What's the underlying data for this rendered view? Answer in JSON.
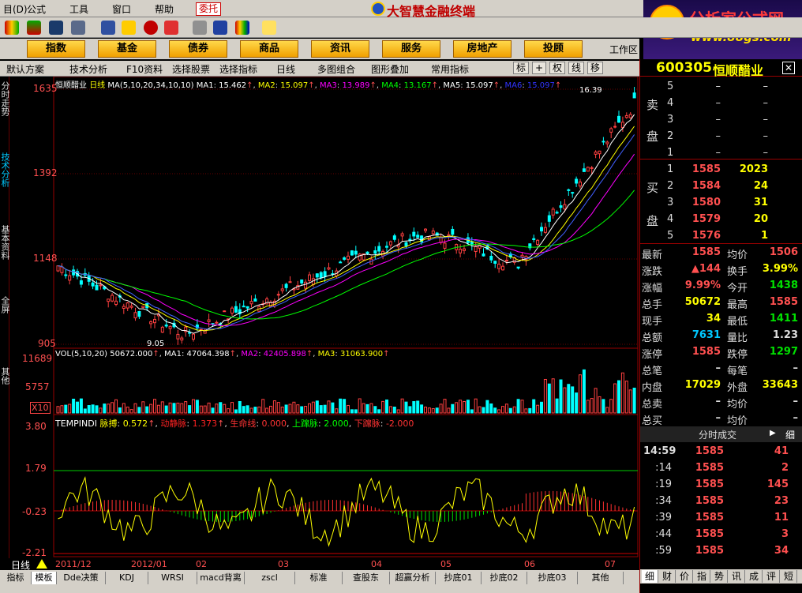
{
  "menu": {
    "items": [
      "目(D)",
      "公式",
      "工具",
      "窗口",
      "帮助"
    ],
    "delegate": "委托",
    "app_title": "大智慧金融终端"
  },
  "brand": {
    "name": "分析家公式网",
    "url": "www.88gs.com"
  },
  "categories": [
    "指数",
    "基金",
    "债券",
    "商品",
    "资讯",
    "服务",
    "房地产",
    "投顾"
  ],
  "work_area": "工作区",
  "funcbar": {
    "items": [
      "默认方案",
      "技术分析",
      "F10资料",
      "选择股票",
      "选择指标",
      "日线",
      "多图组合",
      "图形叠加",
      "常用指标"
    ],
    "toggles": [
      "标",
      "权",
      "线",
      "移"
    ]
  },
  "side_tabs": [
    "分时走势",
    "技术分析",
    "基本资料",
    "全屏",
    "其他"
  ],
  "price_chart": {
    "title": "恒顺醋业",
    "period": "日线",
    "ma_label": "MA(5,10,20,34,10,10)",
    "ma": [
      {
        "name": "MA1",
        "value": "15.462",
        "color": "#ffffff"
      },
      {
        "name": "MA2",
        "value": "15.097",
        "color": "#ffff00"
      },
      {
        "name": "MA3",
        "value": "13.989",
        "color": "#ff00ff"
      },
      {
        "name": "MA4",
        "value": "13.167",
        "color": "#00ff00"
      },
      {
        "name": "MA5",
        "value": "15.097",
        "color": "#ffffff"
      },
      {
        "name": "MA6",
        "value": "15.097",
        "color": "#0000ff"
      }
    ],
    "y_ticks": [
      "1635",
      "1392",
      "1148",
      "905"
    ],
    "high_label": "16.39",
    "low_label": "9.05"
  },
  "vol_chart": {
    "label": "VOL(5,10,20)",
    "value": "50672.000",
    "ma": [
      {
        "name": "MA1",
        "value": "47064.398",
        "color": "#ffffff"
      },
      {
        "name": "MA2",
        "value": "42405.898",
        "color": "#ff00ff"
      },
      {
        "name": "MA3",
        "value": "31063.900",
        "color": "#ffff00"
      }
    ],
    "y_ticks": [
      "11689",
      "5757"
    ],
    "unit": "X10"
  },
  "ind_chart": {
    "label": "TEMPINDI",
    "lines": [
      {
        "name": "脉搏",
        "value": "0.572",
        "color": "#ffff00"
      },
      {
        "name": "动静脉",
        "value": "1.373",
        "color": "#ff2020"
      },
      {
        "name": "生命线",
        "value": "0.000",
        "color": "#ff3030"
      },
      {
        "name": "上蹿脉",
        "value": "2.000",
        "color": "#00ff00"
      },
      {
        "name": "下蹿脉",
        "value": "-2.000",
        "color": "#ff3030"
      }
    ],
    "y_ticks": [
      "3.80",
      "1.79",
      "-0.23",
      "-2.21"
    ]
  },
  "x_axis": {
    "period": "日线",
    "labels": [
      "2011/12",
      "2012/01",
      "02",
      "03",
      "04",
      "05",
      "06",
      "07"
    ]
  },
  "bottom_tabs": [
    "指标",
    "模板",
    "Dde决策",
    "KDJ",
    "WRSI",
    "macd背离",
    "zscl",
    "标准",
    "查股东",
    "超赢分析",
    "抄底01",
    "抄底02",
    "抄底03",
    "其他"
  ],
  "quote": {
    "code": "600305",
    "name": "恒顺醋业",
    "sell_label": [
      "卖",
      "盘"
    ],
    "buy_label": [
      "买",
      "盘"
    ],
    "asks": [
      {
        "level": "5",
        "price": "–",
        "vol": "–"
      },
      {
        "level": "4",
        "price": "–",
        "vol": "–"
      },
      {
        "level": "3",
        "price": "–",
        "vol": "–"
      },
      {
        "level": "2",
        "price": "–",
        "vol": "–"
      },
      {
        "level": "1",
        "price": "–",
        "vol": "–"
      }
    ],
    "bids": [
      {
        "level": "1",
        "price": "1585",
        "vol": "2023"
      },
      {
        "level": "2",
        "price": "1584",
        "vol": "24"
      },
      {
        "level": "3",
        "price": "1580",
        "vol": "31"
      },
      {
        "level": "4",
        "price": "1579",
        "vol": "20"
      },
      {
        "level": "5",
        "price": "1576",
        "vol": "1"
      }
    ],
    "stats": [
      {
        "l1": "最新",
        "v1": "1585",
        "c1": "#ff5050",
        "l2": "均价",
        "v2": "1506",
        "c2": "#ff5050"
      },
      {
        "l1": "涨跌",
        "v1": "▲144",
        "c1": "#ff5050",
        "l2": "换手",
        "v2": "3.99%",
        "c2": "#ffff00"
      },
      {
        "l1": "涨幅",
        "v1": "9.99%",
        "c1": "#ff5050",
        "l2": "今开",
        "v2": "1438",
        "c2": "#00e000"
      },
      {
        "l1": "总手",
        "v1": "50672",
        "c1": "#ffff00",
        "l2": "最高",
        "v2": "1585",
        "c2": "#ff5050"
      },
      {
        "l1": "现手",
        "v1": "34",
        "c1": "#ffff00",
        "l2": "最低",
        "v2": "1411",
        "c2": "#00e000"
      },
      {
        "l1": "总额",
        "v1": "7631",
        "c1": "#00c8ff",
        "l2": "量比",
        "v2": "1.23",
        "c2": "#dddddd"
      },
      {
        "l1": "涨停",
        "v1": "1585",
        "c1": "#ff5050",
        "l2": "跌停",
        "v2": "1297",
        "c2": "#00e000"
      },
      {
        "l1": "总笔",
        "v1": "–",
        "c1": "#dddddd",
        "l2": "每笔",
        "v2": "–",
        "c2": "#dddddd"
      },
      {
        "l1": "内盘",
        "v1": "17029",
        "c1": "#ffff00",
        "l2": "外盘",
        "v2": "33643",
        "c2": "#ffff00"
      },
      {
        "l1": "总卖",
        "v1": "–",
        "c1": "#dddddd",
        "l2": "均价",
        "v2": "–",
        "c2": "#dddddd"
      },
      {
        "l1": "总买",
        "v1": "–",
        "c1": "#dddddd",
        "l2": "均价",
        "v2": "–",
        "c2": "#dddddd"
      }
    ],
    "trades_header": "分时成交",
    "trades_tab": "细",
    "trades": [
      {
        "time": "14:59",
        "price": "1585",
        "vol": "41"
      },
      {
        "time": ":14",
        "price": "1585",
        "vol": "2"
      },
      {
        "time": ":19",
        "price": "1585",
        "vol": "145"
      },
      {
        "time": ":34",
        "price": "1585",
        "vol": "23"
      },
      {
        "time": ":39",
        "price": "1585",
        "vol": "11"
      },
      {
        "time": ":44",
        "price": "1585",
        "vol": "3"
      },
      {
        "time": ":59",
        "price": "1585",
        "vol": "34"
      }
    ],
    "footer_tabs": [
      "细",
      "财",
      "价",
      "指",
      "势",
      "讯",
      "成",
      "评",
      "短"
    ]
  }
}
